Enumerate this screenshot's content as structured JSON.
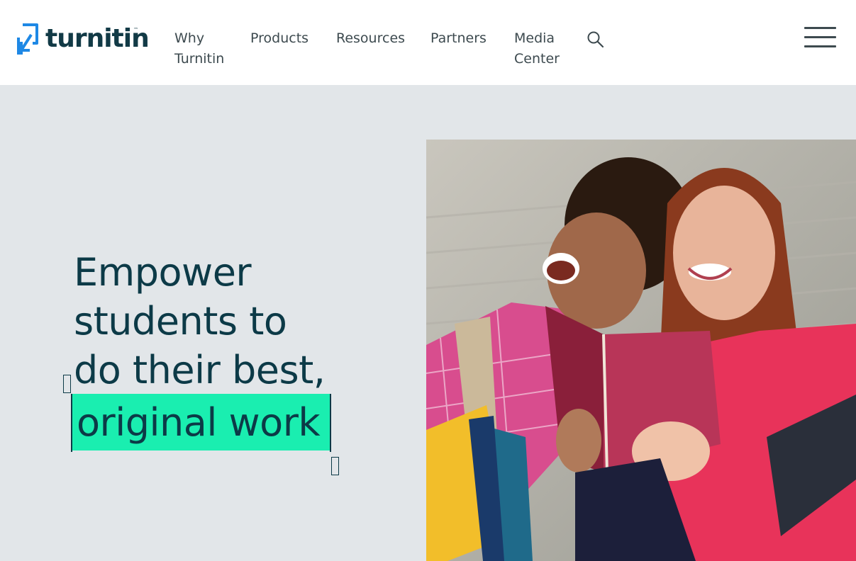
{
  "header": {
    "logo_text": "turnitin",
    "logo_tm": "™",
    "nav": [
      {
        "line1": "Why",
        "line2": "Turnitin"
      },
      {
        "line1": "Products",
        "line2": ""
      },
      {
        "line1": "Resources",
        "line2": ""
      },
      {
        "line1": "Partners",
        "line2": ""
      },
      {
        "line1": "Media",
        "line2": "Center"
      }
    ]
  },
  "hero": {
    "headline_lines": [
      "Empower",
      "students to",
      "do their best,"
    ],
    "highlight_text": "original work"
  },
  "colors": {
    "brand_dark": "#0c3a47",
    "highlight": "#1aeeb0",
    "hero_bg": "#e2e6e9",
    "logo_blue": "#1e88e5"
  },
  "icons": {
    "search": "search-icon",
    "menu": "hamburger-menu-icon",
    "logo": "turnitin-logo-icon"
  }
}
